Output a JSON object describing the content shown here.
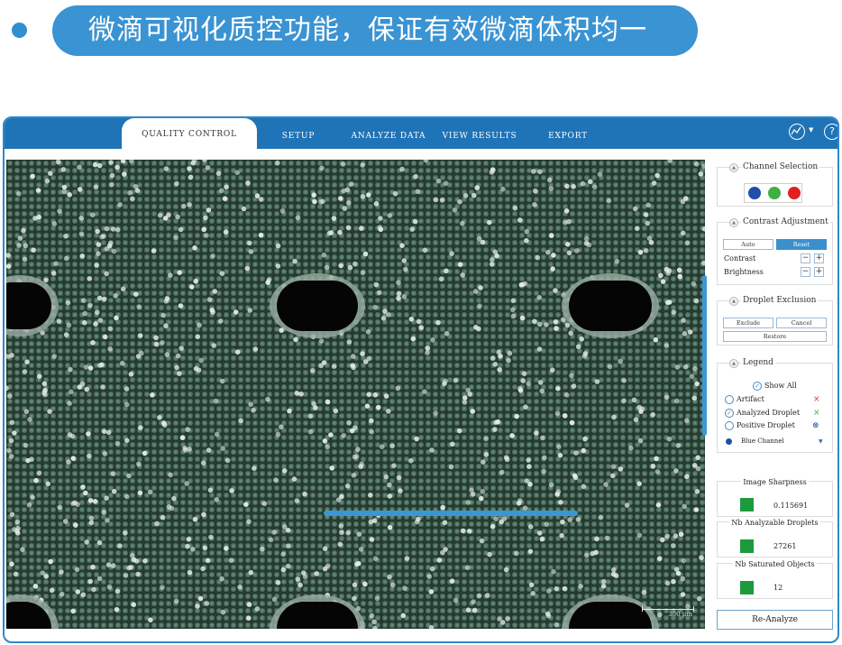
{
  "slide": {
    "headline": "微滴可视化质控功能，保证有效微滴体积均一"
  },
  "nav": {
    "tabs": [
      {
        "label": "QUALITY CONTROL",
        "active": true
      },
      {
        "label": "SETUP"
      },
      {
        "label": "ANALYZE DATA"
      },
      {
        "label": "VIEW RESULTS"
      },
      {
        "label": "EXPORT"
      }
    ],
    "help_symbol": "?",
    "account_icon": "chart-user-icon"
  },
  "viewer": {
    "scale_label": "300 µm",
    "colors": {
      "background": "#253a30",
      "droplet": "#4f6e5f",
      "bright_droplet": "#e6efe9",
      "hole": "#050505"
    }
  },
  "channel_selection": {
    "title": "Channel Selection",
    "channels": [
      {
        "name": "blue",
        "color": "#1f4fa8"
      },
      {
        "name": "green",
        "color": "#3cb043"
      },
      {
        "name": "red",
        "color": "#e02020"
      }
    ]
  },
  "contrast_adjustment": {
    "title": "Contrast Adjustment",
    "auto_label": "Auto",
    "reset_label": "Reset",
    "contrast_label": "Contrast",
    "brightness_label": "Brightness",
    "minus": "−",
    "plus": "+"
  },
  "droplet_exclusion": {
    "title": "Droplet Exclusion",
    "exclude_label": "Exclude",
    "cancel_label": "Cancel",
    "restore_label": "Restore"
  },
  "legend": {
    "title": "Legend",
    "show_all": "Show All",
    "items": [
      {
        "label": "Artifact",
        "mark": "×",
        "mark_color": "#e03030"
      },
      {
        "label": "Analyzed Droplet",
        "mark": "×",
        "mark_color": "#3cb043"
      },
      {
        "label": "Positive Droplet",
        "mark": "⊗",
        "mark_color": "#1f4fa8"
      }
    ],
    "channel_select": "Blue Channel"
  },
  "metrics": [
    {
      "title": "Image Sharpness",
      "value": "0.115691"
    },
    {
      "title": "Nb Analyzable Droplets",
      "value": "27261"
    },
    {
      "title": "Nb Saturated Objects",
      "value": "12"
    }
  ],
  "reanalyze_label": "Re-Analyze"
}
